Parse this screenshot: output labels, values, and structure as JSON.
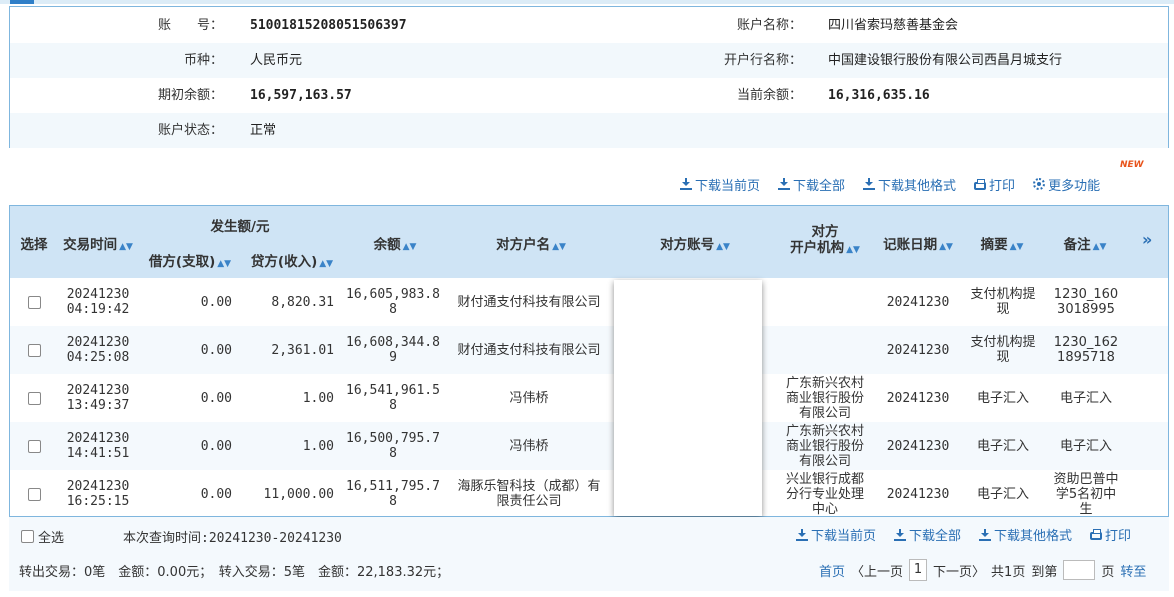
{
  "account_info": {
    "account_no_label": "账　　号：",
    "account_no": "51001815208051506397",
    "account_name_label": "账户名称：",
    "account_name": "四川省索玛慈善基金会",
    "currency_label": "币种：",
    "currency": "人民币元",
    "bank_label": "开户行名称：",
    "bank": "中国建设银行股份有限公司西昌月城支行",
    "opening_balance_label": "期初余额：",
    "opening_balance": "16,597,163.57",
    "current_balance_label": "当前余额：",
    "current_balance": "16,316,635.16",
    "status_label": "账户状态：",
    "status": "正常"
  },
  "toolbar": {
    "download_page": "下载当前页",
    "download_all": "下载全部",
    "download_other": "下载其他格式",
    "print": "打印",
    "more": "更多功能",
    "new_badge": "NEW"
  },
  "table": {
    "headers": {
      "select": "选择",
      "time": "交易时间",
      "amount_group": "发生额/元",
      "debit": "借方(支取)",
      "credit": "贷方(收入)",
      "balance": "余额",
      "counter_name": "对方户名",
      "counter_account": "对方账号",
      "counter_bank_1": "对方",
      "counter_bank_2": "开户机构",
      "post_date": "记账日期",
      "summary": "摘要",
      "remark": "备注",
      "more": "»"
    },
    "rows": [
      {
        "date": "20241230",
        "time": "04:19:42",
        "debit": "0.00",
        "credit": "8,820.31",
        "balance": "16,605,983.88",
        "counter_name": "财付通支付科技有限公司",
        "counter_bank": "",
        "post_date": "20241230",
        "summary": "支付机构提现",
        "remark": "1230_1603018995"
      },
      {
        "date": "20241230",
        "time": "04:25:08",
        "debit": "0.00",
        "credit": "2,361.01",
        "balance": "16,608,344.89",
        "counter_name": "财付通支付科技有限公司",
        "counter_bank": "",
        "post_date": "20241230",
        "summary": "支付机构提现",
        "remark": "1230_1621895718"
      },
      {
        "date": "20241230",
        "time": "13:49:37",
        "debit": "0.00",
        "credit": "1.00",
        "balance": "16,541,961.58",
        "counter_name": "冯伟桥",
        "counter_bank": "广东新兴农村商业银行股份有限公司",
        "post_date": "20241230",
        "summary": "电子汇入",
        "remark": "电子汇入"
      },
      {
        "date": "20241230",
        "time": "14:41:51",
        "debit": "0.00",
        "credit": "1.00",
        "balance": "16,500,795.78",
        "counter_name": "冯伟桥",
        "counter_bank": "广东新兴农村商业银行股份有限公司",
        "post_date": "20241230",
        "summary": "电子汇入",
        "remark": "电子汇入"
      },
      {
        "date": "20241230",
        "time": "16:25:15",
        "debit": "0.00",
        "credit": "11,000.00",
        "balance": "16,511,795.78",
        "counter_name": "海豚乐智科技（成都）有限责任公司",
        "counter_bank": "兴业银行成都分行专业处理中心",
        "post_date": "20241230",
        "summary": "电子汇入",
        "remark": "资助巴普中学5名初中生"
      }
    ]
  },
  "footer": {
    "select_all": "全选",
    "query_time": "本次查询时间:20241230-20241230",
    "summary_text": "转出交易：0笔　金额：0.00元；　转入交易：5笔　金额：22,183.32元；",
    "first_page": "首页",
    "prev_page": "〈上一页",
    "current_page": "1",
    "next_page": "下一页〉",
    "total_pages": "共1页",
    "goto_label": "到第",
    "page_unit": "页",
    "goto_button": "转至"
  }
}
